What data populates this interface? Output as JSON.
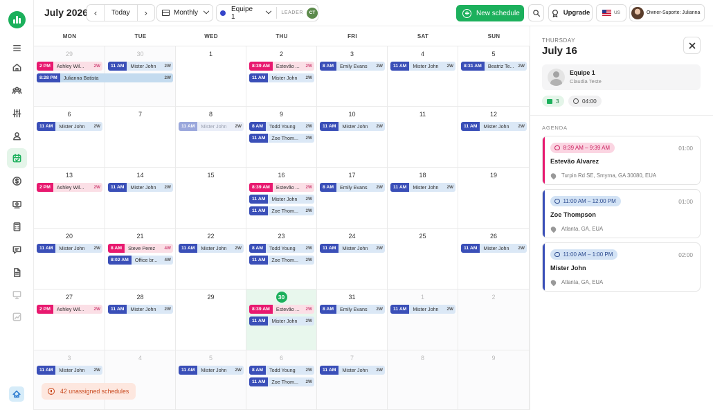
{
  "header": {
    "title": "July 2026",
    "today_label": "Today",
    "prev_icon": "chevron-left-icon",
    "next_icon": "chevron-right-icon",
    "view_label": "Monthly",
    "team_label": "Equipe 1",
    "leader_label": "LEADER",
    "leader_initials": "CT",
    "new_schedule_label": "New schedule",
    "upgrade_label": "Upgrade",
    "locale_label": "US",
    "user_label": "Owner-Suporte: Julianna"
  },
  "weekdays": [
    "MON",
    "TUE",
    "WED",
    "THU",
    "FRI",
    "SAT",
    "SUN"
  ],
  "days": [
    "29",
    "30",
    "1",
    "2",
    "3",
    "4",
    "5",
    "6",
    "7",
    "8",
    "9",
    "10",
    "11",
    "12",
    "13",
    "14",
    "15",
    "16",
    "17",
    "18",
    "19",
    "20",
    "21",
    "22",
    "23",
    "24",
    "25",
    "26",
    "27",
    "28",
    "29",
    "30",
    "31",
    "1",
    "2",
    "3",
    "4",
    "5",
    "6",
    "7",
    "8",
    "9"
  ],
  "events": [
    {
      "time": "2 PM",
      "name": "Ashley Wil...",
      "badge": "2W"
    },
    {
      "time": "11 AM",
      "name": "Mister John",
      "badge": "2W"
    },
    {
      "time": "8:28 PM",
      "name": "Julianna Batista",
      "badge": "2W"
    },
    {
      "time": "8:39 AM",
      "name": "Estevão ...",
      "badge": "2W"
    },
    {
      "time": "11 AM",
      "name": "Mister John",
      "badge": "2W"
    },
    {
      "time": "8 AM",
      "name": "Emily Evans",
      "badge": "2W"
    },
    {
      "time": "11 AM",
      "name": "Mister John",
      "badge": "2W"
    },
    {
      "time": "8:31 AM",
      "name": "Beatriz Te...",
      "badge": "2W"
    },
    {
      "time": "11 AM",
      "name": "Mister John",
      "badge": "2W"
    },
    {
      "time": "11 AM",
      "name": "Mister John",
      "badge": "2W"
    },
    {
      "time": "8 AM",
      "name": "Todd Young",
      "badge": "2W"
    },
    {
      "time": "11 AM",
      "name": "Zoe Thom...",
      "badge": "2W"
    },
    {
      "time": "11 AM",
      "name": "Mister John",
      "badge": "2W"
    },
    {
      "time": "11 AM",
      "name": "Mister John",
      "badge": "2W"
    },
    {
      "time": "2 PM",
      "name": "Ashley Wil...",
      "badge": "2W"
    },
    {
      "time": "11 AM",
      "name": "Mister John",
      "badge": "2W"
    },
    {
      "time": "8:39 AM",
      "name": "Estevão ...",
      "badge": "2W"
    },
    {
      "time": "11 AM",
      "name": "Mister John",
      "badge": "2W"
    },
    {
      "time": "11 AM",
      "name": "Zoe Thom...",
      "badge": "2W"
    },
    {
      "time": "8 AM",
      "name": "Emily Evans",
      "badge": "2W"
    },
    {
      "time": "11 AM",
      "name": "Mister John",
      "badge": "2W"
    },
    {
      "time": "11 AM",
      "name": "Mister John",
      "badge": "2W"
    },
    {
      "time": "8 AM",
      "name": "Steve Perez",
      "badge": "4W"
    },
    {
      "time": "8:02 AM",
      "name": "Office br...",
      "badge": "4W"
    },
    {
      "time": "11 AM",
      "name": "Mister John",
      "badge": "2W"
    },
    {
      "time": "8 AM",
      "name": "Todd Young",
      "badge": "2W"
    },
    {
      "time": "11 AM",
      "name": "Zoe Thom...",
      "badge": "2W"
    },
    {
      "time": "11 AM",
      "name": "Mister John",
      "badge": "2W"
    },
    {
      "time": "11 AM",
      "name": "Mister John",
      "badge": "2W"
    },
    {
      "time": "2 PM",
      "name": "Ashley Wil...",
      "badge": "2W"
    },
    {
      "time": "11 AM",
      "name": "Mister John",
      "badge": "2W"
    },
    {
      "time": "8:39 AM",
      "name": "Estevão ...",
      "badge": "2W"
    },
    {
      "time": "11 AM",
      "name": "Mister John",
      "badge": "2W"
    },
    {
      "time": "8 AM",
      "name": "Emily Evans",
      "badge": "2W"
    },
    {
      "time": "11 AM",
      "name": "Mister John",
      "badge": "2W"
    },
    {
      "time": "11 AM",
      "name": "Mister John",
      "badge": "2W"
    },
    {
      "time": "11 AM",
      "name": "Mister John",
      "badge": "2W"
    },
    {
      "time": "8 AM",
      "name": "Todd Young",
      "badge": "2W"
    },
    {
      "time": "11 AM",
      "name": "Zoe Thom...",
      "badge": "2W"
    },
    {
      "time": "11 AM",
      "name": "Mister John",
      "badge": "2W"
    }
  ],
  "unassigned_label": "42 unassigned schedules",
  "panel": {
    "day_of_week": "THURSDAY",
    "date": "July 16",
    "team_name": "Equipe 1",
    "team_sub": "Claudia Teste",
    "count": "3",
    "hours": "04:00",
    "agenda_label": "AGENDA",
    "items": [
      {
        "time": "8:39 AM – 9:39 AM",
        "duration": "01:00",
        "name": "Estevão Alvarez",
        "address": "Turpin Rd SE, Smyrna, GA 30080, EUA"
      },
      {
        "time": "11:00 AM – 12:00 PM",
        "duration": "01:00",
        "name": "Zoe Thompson",
        "address": "Atlanta, GA, EUA"
      },
      {
        "time": "11:00 AM – 1:00 PM",
        "duration": "02:00",
        "name": "Mister John",
        "address": "Atlanta, GA, EUA"
      }
    ]
  },
  "colors": {
    "brand": "#1cb05c",
    "event_blue": "#3a4fb8",
    "event_pink": "#e8196f"
  }
}
